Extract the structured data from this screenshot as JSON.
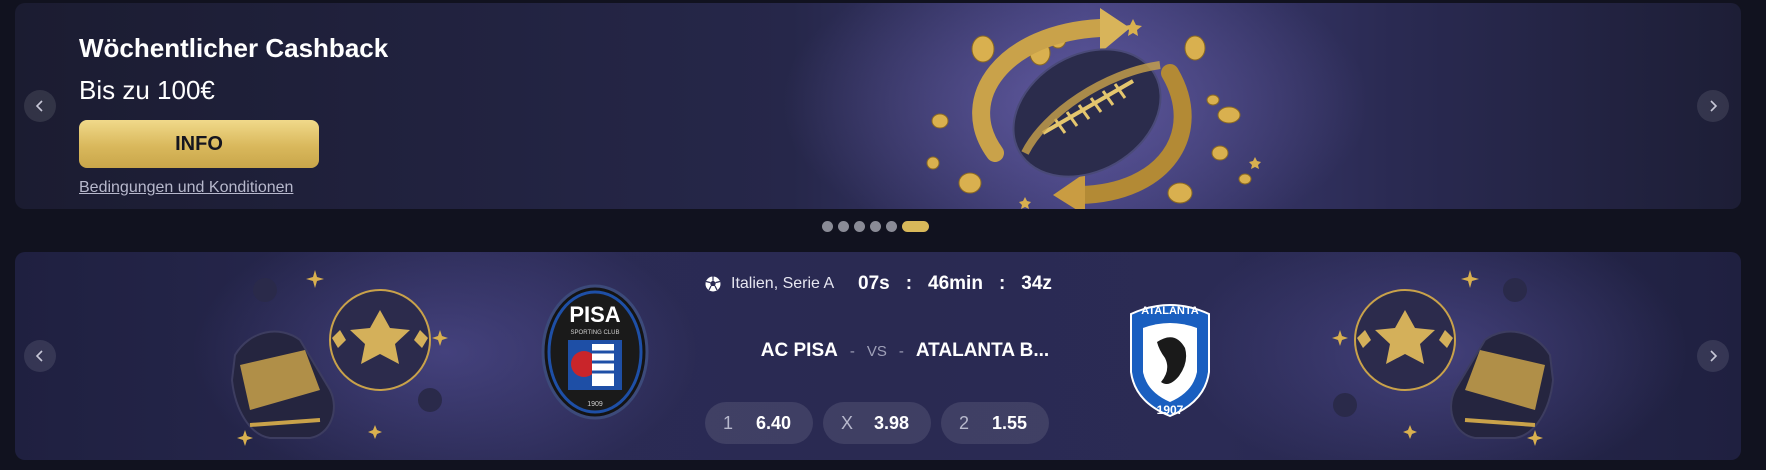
{
  "promo": {
    "title": "Wöchentlicher Cashback",
    "subtitle": "Bis zu 100€",
    "button_label": "INFO",
    "terms_link": "Bedingungen und Konditionen",
    "artwork": "golden-football-cashback-icon"
  },
  "carousel": {
    "dot_count": 6,
    "active_index": 5
  },
  "match": {
    "league": "Italien, Serie A",
    "league_icon": "soccer-ball-icon",
    "countdown": {
      "seconds": "07s",
      "sep1": ":",
      "minutes": "46min",
      "sep2": ":",
      "third": "34z"
    },
    "home_team": "AC PISA",
    "away_team": "ATALANTA B...",
    "vs_prefix": "-",
    "vs_label": "VS",
    "vs_suffix": "-",
    "home_crest": {
      "name": "PISA",
      "sub": "SPORTING CLUB",
      "year": "1909"
    },
    "away_crest": {
      "name": "ATALANTA",
      "year": "1907"
    },
    "odds": [
      {
        "label": "1",
        "value": "6.40"
      },
      {
        "label": "X",
        "value": "3.98"
      },
      {
        "label": "2",
        "value": "1.55"
      }
    ]
  },
  "colors": {
    "accent_gold": "#d8b85a",
    "background": "#11121f",
    "banner_purple": "#2a2a52"
  }
}
